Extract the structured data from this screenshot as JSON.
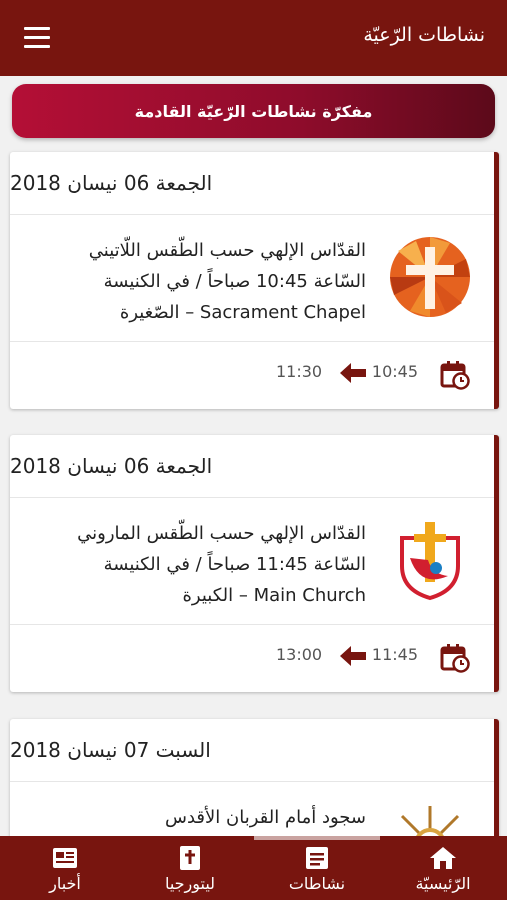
{
  "header": {
    "title": "نشاطات الرّعيّة",
    "menu_icon": "hamburger-menu-icon"
  },
  "banner": {
    "label": "مفكرّة نشاطات الرّعيّة القادمة"
  },
  "events": [
    {
      "date": "الجمعة 06 نيسان 2018",
      "line1": "القدّاس الإلهي حسب الطّقس اللّاتيني",
      "line2": "السّاعة 10:45 صباحاً / في الكنيسة",
      "line3": "الصّغيرة – Sacrament Chapel",
      "start": "10:45",
      "end": "11:30",
      "logo": "cross-sunburst-logo"
    },
    {
      "date": "الجمعة 06 نيسان 2018",
      "line1": "القدّاس الإلهي حسب الطّقس الماروني",
      "line2": "السّاعة 11:45 صباحاً / في الكنيسة",
      "line3": "الكبيرة – Main Church",
      "start": "11:45",
      "end": "13:00",
      "logo": "youth-day-cross-logo"
    },
    {
      "date": "السبت 07 نيسان 2018",
      "line1": "سجود أمام القربان الأقدس",
      "logo": "monstrance-logo"
    }
  ],
  "nav": {
    "home": "الرّئيسيّة",
    "activities": "نشاطات",
    "liturgy": "ليتورجيا",
    "news": "أخبار"
  },
  "colors": {
    "primary": "#78150f",
    "banner_start": "#b40f36",
    "banner_end": "#5c0a1a"
  }
}
